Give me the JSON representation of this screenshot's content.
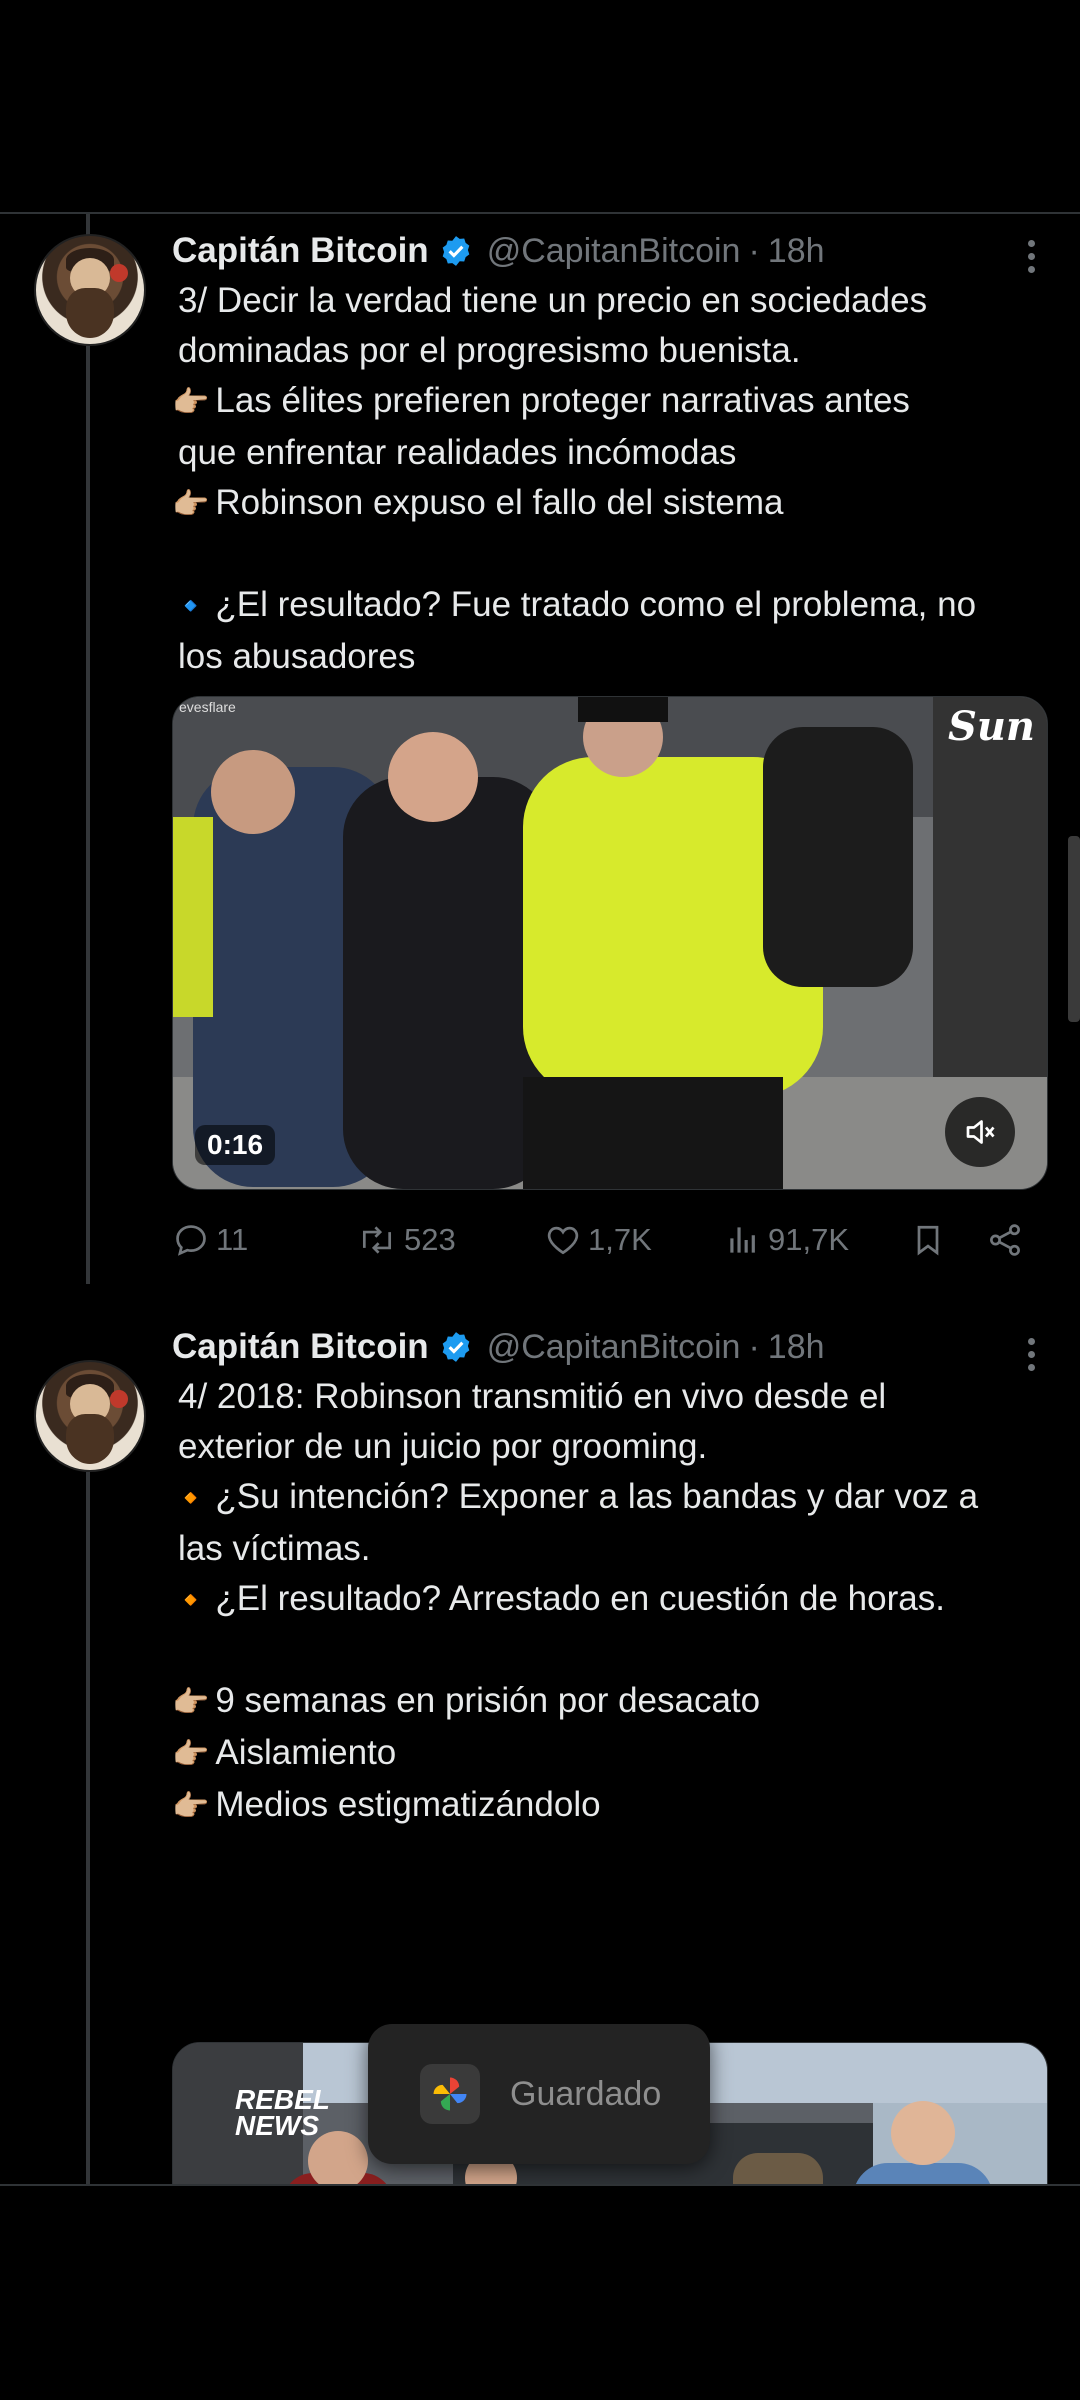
{
  "tweets": [
    {
      "name": "Capitán Bitcoin",
      "handle": "@CapitanBitcoin",
      "separator": "·",
      "time": "18h",
      "lines": [
        {
          "emoji": "",
          "text": "3/ Decir la verdad tiene un precio en sociedades"
        },
        {
          "emoji": "",
          "text": "dominadas por el progresismo buenista."
        },
        {
          "emoji": "👉🏼",
          "text": "Las élites prefieren proteger narrativas antes"
        },
        {
          "emoji": "",
          "text": "que enfrentar realidades incómodas"
        },
        {
          "emoji": "👉🏼",
          "text": "Robinson expuso el fallo del sistema"
        },
        {
          "emoji": "",
          "text": ""
        },
        {
          "emoji": "🔹",
          "text": "¿El resultado? Fue tratado como el problema, no"
        },
        {
          "emoji": "",
          "text": "los abusadores"
        }
      ],
      "media": {
        "duration": "0:16",
        "brand": "Sun",
        "watermark": "evesflare"
      },
      "actions": {
        "replies": "11",
        "reposts": "523",
        "likes": "1,7K",
        "views": "91,7K"
      }
    },
    {
      "name": "Capitán Bitcoin",
      "handle": "@CapitanBitcoin",
      "separator": "·",
      "time": "18h",
      "lines": [
        {
          "emoji": "",
          "text": "4/ 2018: Robinson transmitió en vivo desde el"
        },
        {
          "emoji": "",
          "text": "exterior de un juicio por grooming."
        },
        {
          "emoji": "🔸",
          "text": "¿Su intención? Exponer a las bandas y dar voz a"
        },
        {
          "emoji": "",
          "text": "las víctimas."
        },
        {
          "emoji": "🔸",
          "text": "¿El resultado? Arrestado en cuestión de horas."
        },
        {
          "emoji": "",
          "text": ""
        },
        {
          "emoji": "👉🏼",
          "text": "9 semanas en prisión por desacato"
        },
        {
          "emoji": "👉🏼",
          "text": "Aislamiento"
        },
        {
          "emoji": "👉🏼",
          "text": "Medios estigmatizándolo"
        }
      ],
      "media": {
        "brand": "REBEL NEWS"
      }
    }
  ],
  "toast": {
    "text": "Guardado",
    "icon": "google-photos-icon"
  },
  "colors": {
    "background": "#000000",
    "text": "#e7e9ea",
    "muted": "#71767b",
    "verified": "#1d9bf0"
  }
}
